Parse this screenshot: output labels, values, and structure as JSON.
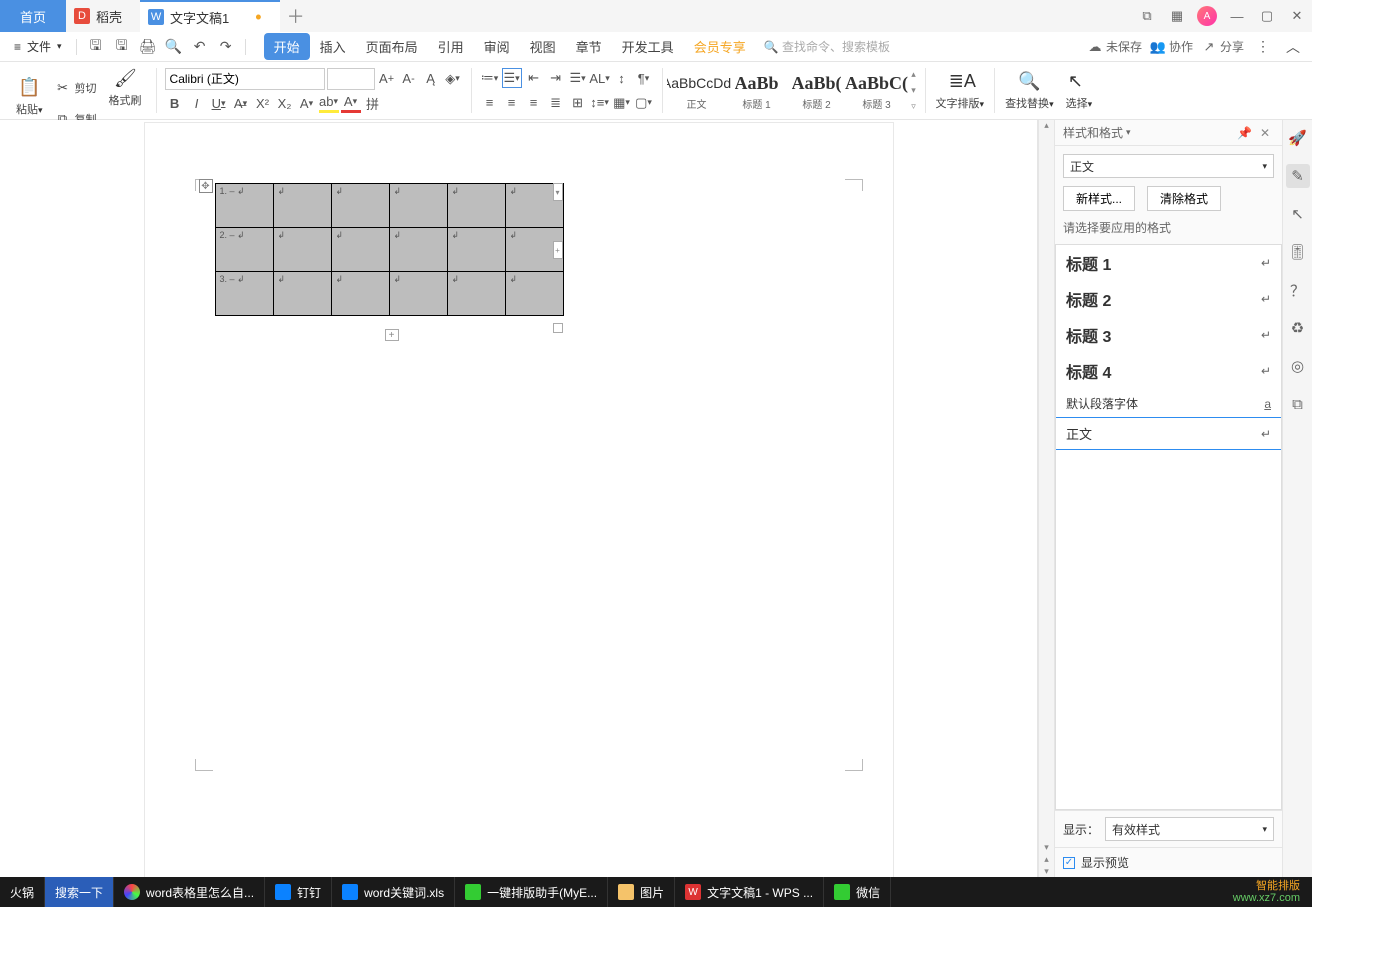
{
  "titlebar": {
    "tab_home": "首页",
    "tab_docer": "稻壳",
    "tab_doc": "文字文稿1"
  },
  "menubar": {
    "file": "文件",
    "tabs": [
      "开始",
      "插入",
      "页面布局",
      "引用",
      "审阅",
      "视图",
      "章节",
      "开发工具",
      "会员专享"
    ],
    "search_placeholder": "查找命令、搜索模板",
    "unsaved": "未保存",
    "coop": "协作",
    "share": "分享"
  },
  "ribbon": {
    "paste": "粘贴",
    "cut": "剪切",
    "copy": "复制",
    "format_painter": "格式刷",
    "font_name": "Calibri (正文)",
    "font_size": "",
    "styles": [
      {
        "preview": "AaBbCcDd",
        "label": "正文"
      },
      {
        "preview": "AaBb",
        "label": "标题 1"
      },
      {
        "preview": "AaBb(",
        "label": "标题 2"
      },
      {
        "preview": "AaBbC(",
        "label": "标题 3"
      }
    ],
    "text_layout": "文字排版",
    "find_replace": "查找替换",
    "select": "选择"
  },
  "doc": {
    "rows": [
      "1. – ↲",
      "2. – ↲",
      "3. – ↲"
    ],
    "cellmark": "↲"
  },
  "panel": {
    "title": "样式和格式",
    "current": "正文",
    "new_style": "新样式...",
    "clear_fmt": "清除格式",
    "choose": "请选择要应用的格式",
    "opts": [
      "标题 1",
      "标题 2",
      "标题 3",
      "标题 4"
    ],
    "default_font": "默认段落字体",
    "body": "正文",
    "show": "显示：",
    "show_value": "有效样式",
    "preview": "显示预览"
  },
  "sidetool": [
    "rocket",
    "pencil",
    "cursor",
    "tune",
    "help",
    "recycle",
    "target",
    "panel-toggle"
  ],
  "taskbar": {
    "items": [
      {
        "label": "火锅",
        "color": "#333"
      },
      {
        "label": "搜索一下",
        "color": "#2b5eb8"
      },
      {
        "label": "word表格里怎么自...",
        "icon": "🌐",
        "color": "#222"
      },
      {
        "label": "钉钉",
        "icon": "📘",
        "color": "#222"
      },
      {
        "label": "word关键词.xls",
        "icon": "📄",
        "color": "#222"
      },
      {
        "label": "一键排版助手(MyE...",
        "icon": "🧩",
        "color": "#222"
      },
      {
        "label": "图片",
        "icon": "📁",
        "color": "#222"
      },
      {
        "label": "文字文稿1 - WPS ...",
        "icon": "W",
        "color": "#222"
      },
      {
        "label": "微信",
        "icon": "💬",
        "color": "#222"
      }
    ],
    "wm1": "智能排版",
    "wm2": "www.xz7.com"
  }
}
